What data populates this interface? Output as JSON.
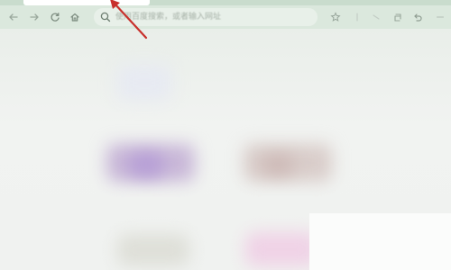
{
  "browser": {
    "address_bar": {
      "placeholder": "使用百度搜索，或者输入网址"
    },
    "icons": {
      "back": "arrow-left-icon",
      "forward": "arrow-right-icon",
      "reload": "reload-icon",
      "home": "home-icon",
      "search": "search-icon",
      "bookmark": "star-icon",
      "toolbar_extra": [
        "extension-icon",
        "share-icon",
        "collection-icon",
        "undo-icon"
      ]
    }
  },
  "annotation": {
    "color": "#c8302c"
  },
  "colors": {
    "toolbar": "#dbe8dd",
    "content_background": "#f0f2f0"
  }
}
